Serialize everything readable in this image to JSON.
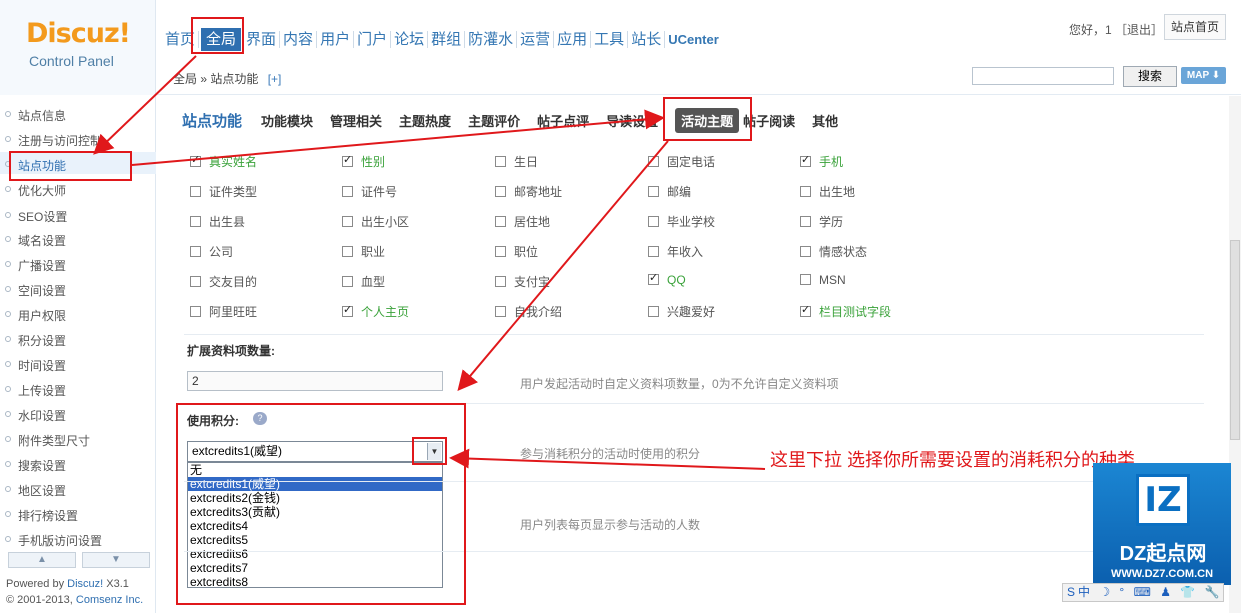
{
  "header": {
    "logo": "Discuz!",
    "logo_sub": "Control Panel",
    "nav": [
      "首页",
      "全局",
      "界面",
      "内容",
      "用户",
      "门户",
      "论坛",
      "群组",
      "防灌水",
      "运营",
      "应用",
      "工具",
      "站长",
      "UCenter"
    ],
    "active_nav_index": 1,
    "user_greeting": "您好，1 ［退出］",
    "home_button": "站点首页"
  },
  "breadcrumb": {
    "text": "全局 » 站点功能",
    "plus": "[+]"
  },
  "search": {
    "button": "搜索",
    "map": "MAP ⬇"
  },
  "sidebar": {
    "items": [
      "站点信息",
      "注册与访问控制",
      "站点功能",
      "优化大师",
      "SEO设置",
      "域名设置",
      "广播设置",
      "空间设置",
      "用户权限",
      "积分设置",
      "时间设置",
      "上传设置",
      "水印设置",
      "附件类型尺寸",
      "搜索设置",
      "地区设置",
      "排行榜设置",
      "手机版访问设置"
    ],
    "active_index": 2,
    "powered_prefix": "Powered by ",
    "powered_brand": "Discuz!",
    "powered_version": " X3.1",
    "copyright_prefix": "© 2001-2013, ",
    "copyright_company": "Comsenz Inc."
  },
  "subnav": {
    "title": "站点功能",
    "tabs": [
      "功能模块",
      "管理相关",
      "主题热度",
      "主题评价",
      "帖子点评",
      "导读设置",
      "活动主题",
      "帖子阅读",
      "其他"
    ],
    "active_index": 6
  },
  "profile_fields": [
    {
      "label": "真实姓名",
      "checked": true
    },
    {
      "label": "性别",
      "checked": true
    },
    {
      "label": "生日",
      "checked": false
    },
    {
      "label": "固定电话",
      "checked": false
    },
    {
      "label": "手机",
      "checked": true
    },
    {
      "label": "证件类型",
      "checked": false
    },
    {
      "label": "证件号",
      "checked": false
    },
    {
      "label": "邮寄地址",
      "checked": false
    },
    {
      "label": "邮编",
      "checked": false
    },
    {
      "label": "出生地",
      "checked": false
    },
    {
      "label": "出生县",
      "checked": false
    },
    {
      "label": "出生小区",
      "checked": false
    },
    {
      "label": "居住地",
      "checked": false
    },
    {
      "label": "毕业学校",
      "checked": false
    },
    {
      "label": "学历",
      "checked": false
    },
    {
      "label": "公司",
      "checked": false
    },
    {
      "label": "职业",
      "checked": false
    },
    {
      "label": "职位",
      "checked": false
    },
    {
      "label": "年收入",
      "checked": false
    },
    {
      "label": "情感状态",
      "checked": false
    },
    {
      "label": "交友目的",
      "checked": false
    },
    {
      "label": "血型",
      "checked": false
    },
    {
      "label": "支付宝",
      "checked": false
    },
    {
      "label": "QQ",
      "checked": true
    },
    {
      "label": "MSN",
      "checked": false
    },
    {
      "label": "阿里旺旺",
      "checked": false
    },
    {
      "label": "个人主页",
      "checked": true
    },
    {
      "label": "自我介绍",
      "checked": false
    },
    {
      "label": "兴趣爱好",
      "checked": false
    },
    {
      "label": "栏目测试字段",
      "checked": true
    }
  ],
  "extend_count": {
    "label": "扩展资料项数量:",
    "value": "2",
    "hint": "用户发起活动时自定义资料项数量，0为不允许自定义资料项"
  },
  "credits": {
    "label": "使用积分:",
    "selected": "extcredits1(威望)",
    "hint": "参与消耗积分的活动时使用的积分",
    "options": [
      "无",
      "extcredits1(威望)",
      "extcredits2(金钱)",
      "extcredits3(贡献)",
      "extcredits4",
      "extcredits5",
      "extcredits6",
      "extcredits7",
      "extcredits8"
    ],
    "highlighted_index": 1
  },
  "participants_hint": "用户列表每页显示参与活动的人数",
  "annotation": "这里下拉  选择你所需要设置的消耗积分的种类",
  "watermark": {
    "badge": "IZ",
    "name": "DZ起点网",
    "url": "WWW.DZ7.COM.CN",
    "ime": "S中 ☽ ° ⌨ ♟ 👕 🔧"
  },
  "colors": {
    "accent": "#2f6fb0",
    "logo": "#f39a1d",
    "annotation": "#e0181b",
    "checked_label": "#3aa23a"
  }
}
